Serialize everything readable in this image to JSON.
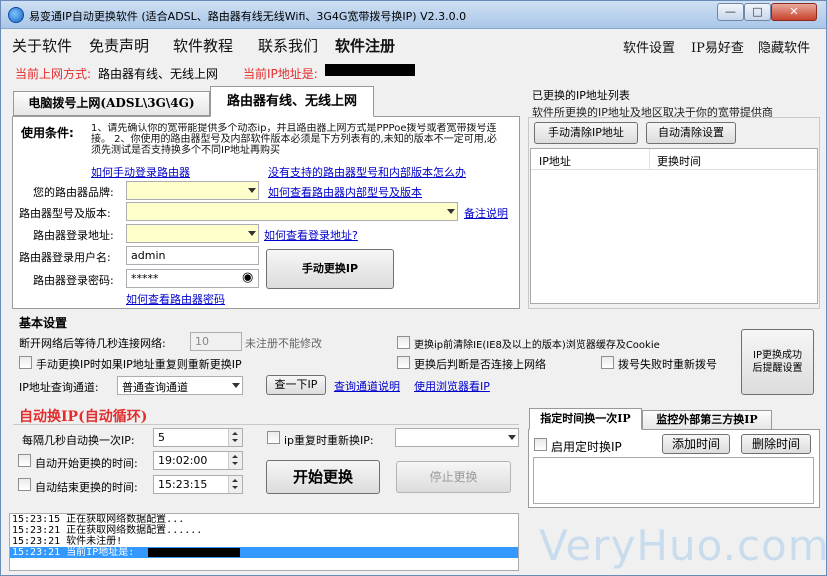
{
  "window": {
    "title": "易变通IP自动更换软件 (适合ADSL、路由器有线无线Wifi、3G4G宽带拨号换IP) V2.3.0.0",
    "min_glyph": "—",
    "max_glyph": "□",
    "close_glyph": "✕"
  },
  "menu": {
    "left": [
      "关于软件",
      "免责声明",
      "软件教程",
      "联系我们",
      "软件注册"
    ],
    "right": [
      "软件设置",
      "IP易好查",
      "隐藏软件"
    ]
  },
  "status": {
    "net_mode_label": "当前上网方式:",
    "net_mode_value": "路由器有线、无线上网",
    "ip_label": "当前IP地址是:"
  },
  "tabs": {
    "dial": "电脑拨号上网(ADSL\\3G\\4G)",
    "router": "路由器有线、无线上网"
  },
  "router_panel": {
    "conditions_label": "使用条件:",
    "conditions_text": "1、请先确认你的宽带能提供多个动态ip，并且路由器上网方式是PPPoe拨号或者宽带拨号连接。  2、你使用的路由器型号及内部软件版本必须是下方列表有的,未知的版本不一定可用,必须先测试是否支持换多个不同IP地址再购买",
    "link_manual_login": "如何手动登录路由器",
    "link_unsupported": "没有支持的路由器型号和内部版本怎么办",
    "brand_label": "您的路由器品牌:",
    "brand_value": "",
    "link_view_model": "如何查看路由器内部型号及版本",
    "model_label": "路由器型号及版本:",
    "model_value": "",
    "link_remark": "备注说明",
    "login_addr_label": "路由器登录地址:",
    "login_addr_value": "",
    "link_view_login": "如何查看登录地址?",
    "user_label": "路由器登录用户名:",
    "user_value": "admin",
    "pwd_label": "路由器登录密码:",
    "pwd_value": "*****",
    "eye_glyph": "◉",
    "link_view_pwd": "如何查看路由器密码",
    "manual_change_btn": "手动更换IP"
  },
  "ip_list": {
    "title": "已更换的IP地址列表",
    "subtitle": "软件所更换的IP地址及地区取决于你的宽带提供商",
    "clear_manual_btn": "手动清除IP地址",
    "auto_clear_btn": "自动清除设置",
    "col_ip": "IP地址",
    "col_time": "更换时间"
  },
  "basic": {
    "title": "基本设置",
    "wait_label": "断开网络后等待几秒连接网络:",
    "wait_value": "10",
    "wait_note": "未注册不能修改",
    "clear_cache_label": "更换ip前清除IE(IE8及以上的版本)浏览器缓存及Cookie",
    "manual_repeat_label": "手动更换IP时如果IP地址重复则重新更换IP",
    "check_connected_label": "更换后判断是否连接上网络",
    "redial_fail_label": "拨号失败时重新拨号",
    "remind_btn_line1": "IP更换成功",
    "remind_btn_line2": "后提醒设置",
    "channel_label": "IP地址查询通道:",
    "channel_value": "普通查询通道",
    "check_btn": "查一下IP",
    "link_channel_desc": "查询通道说明",
    "link_browser": "使用浏览器看IP"
  },
  "auto": {
    "title": "自动换IP(自动循环)",
    "interval_label": "每隔几秒自动换一次IP:",
    "interval_value": "5",
    "repeat_label": "ip重复时重新换IP:",
    "repeat_value": "",
    "start_time_label": "自动开始更换的时间:",
    "start_time_value": "19:02:00",
    "end_time_label": "自动结束更换的时间:",
    "end_time_value": "15:23:15",
    "start_btn": "开始更换",
    "stop_btn": "停止更换"
  },
  "timer": {
    "tab_timed": "指定时间换一次IP",
    "tab_monitor": "监控外部第三方换IP",
    "enable_label": "启用定时换IP",
    "add_btn": "添加时间",
    "delete_btn": "删除时间"
  },
  "log": [
    "15:23:15 正在获取网络数据配置...",
    "15:23:21 正在获取网络数据配置......",
    "15:23:21 软件未注册!",
    "15:23:21 当前IP地址是:"
  ],
  "watermark": "VeryHuo.com",
  "colors": {
    "title_gradient_top": "#cfe0f3",
    "close_red": "#c7412c",
    "accent_red": "#e32d2d",
    "link_blue": "#0000cc",
    "input_yellow": "#ffffcc",
    "selection_blue": "#3399ff"
  }
}
